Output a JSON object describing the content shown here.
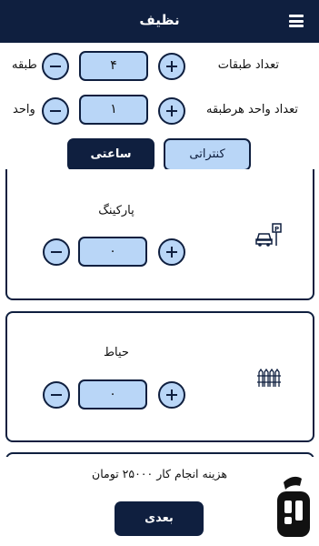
{
  "header": {
    "title": "نظیف"
  },
  "floors": {
    "label": "تعداد طبقات",
    "value": "۴",
    "unit": "طبقه"
  },
  "units": {
    "label": "تعداد واحد هرطبقه",
    "value": "۱",
    "unit": "واحد"
  },
  "tabs": {
    "contract": "کنتراتی",
    "hourly": "ساعتی"
  },
  "parking": {
    "title": "پارکینگ",
    "value": "۰"
  },
  "yard": {
    "title": "حیاط",
    "value": "۰"
  },
  "footer": {
    "cost_text": "هزینه انجام کار ۲۵۰۰۰ تومان",
    "next_label": "بعدی"
  },
  "colors": {
    "navy": "#0f1f3f",
    "light_blue": "#b9d6f7"
  },
  "icons": [
    "menu-icon",
    "parking-icon",
    "fence-icon",
    "minus-icon",
    "plus-icon"
  ]
}
